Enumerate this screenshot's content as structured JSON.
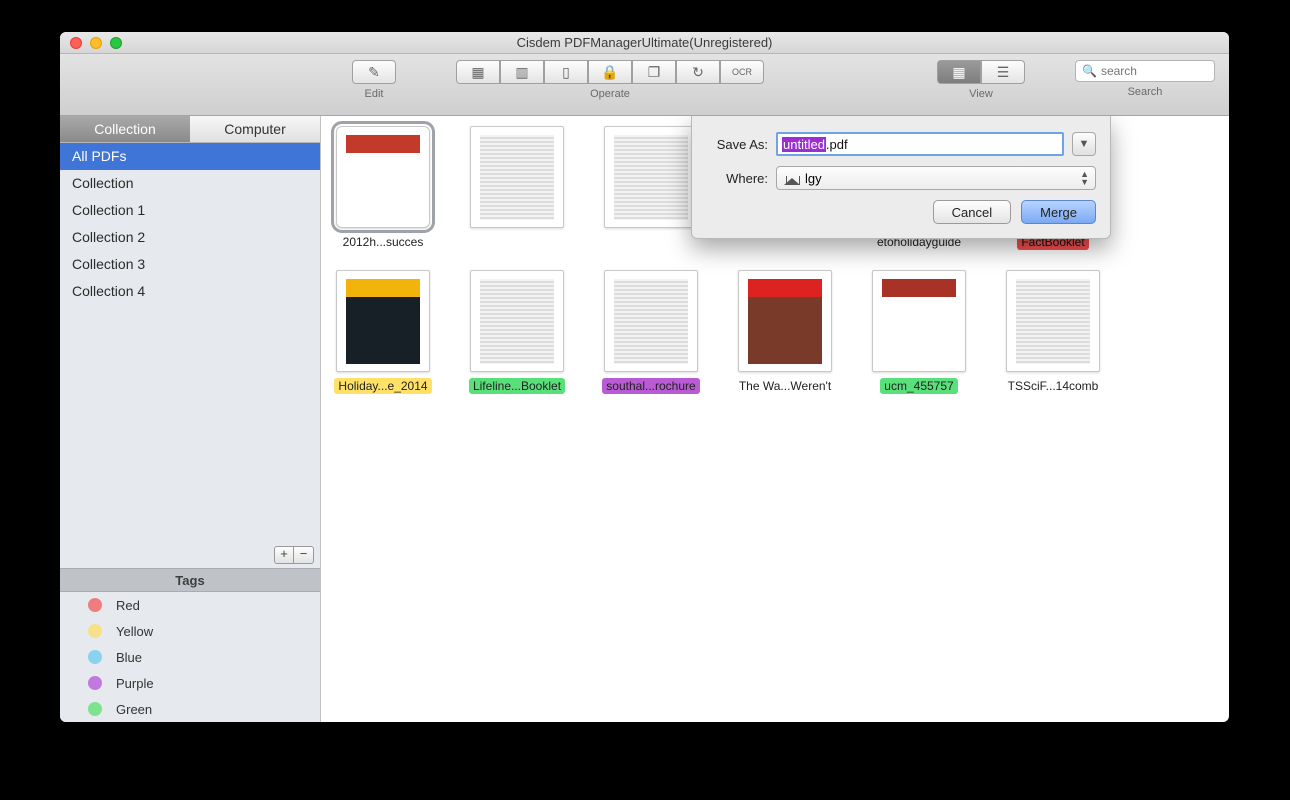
{
  "window": {
    "title": "Cisdem PDFManagerUltimate(Unregistered)"
  },
  "toolbar": {
    "edit_label": "Edit",
    "operate_label": "Operate",
    "view_label": "View",
    "search_label": "Search",
    "search_placeholder": "search"
  },
  "sidebar": {
    "tabs": {
      "collection": "Collection",
      "computer": "Computer"
    },
    "items": [
      {
        "label": "All PDFs",
        "selected": true
      },
      {
        "label": "Collection"
      },
      {
        "label": "Collection 1"
      },
      {
        "label": "Collection 2"
      },
      {
        "label": "Collection 3"
      },
      {
        "label": "Collection 4"
      }
    ],
    "tags_header": "Tags",
    "tags": [
      {
        "label": "Red",
        "color": "#f07d7d"
      },
      {
        "label": "Yellow",
        "color": "#f6e08a"
      },
      {
        "label": "Blue",
        "color": "#8ad3ef"
      },
      {
        "label": "Purple",
        "color": "#c07adf"
      },
      {
        "label": "Green",
        "color": "#7ee38f"
      }
    ]
  },
  "dialog": {
    "save_as_label": "Save As:",
    "where_label": "Where:",
    "filename_selected": "untitled",
    "filename_rest": ".pdf",
    "where_value": "lgy",
    "cancel": "Cancel",
    "merge": "Merge"
  },
  "files": [
    {
      "label": "2012h...succes",
      "tag": "none",
      "selected": true,
      "thumb_bg": "#fff",
      "thumb_accent": "#c43a2a"
    },
    {
      "label": "",
      "tag": "none",
      "thumb_bg": "#fff"
    },
    {
      "label": "",
      "tag": "none",
      "thumb_bg": "#fff"
    },
    {
      "label": "",
      "tag": "none",
      "thumb_bg": "#fff"
    },
    {
      "label": "etoholidayguide",
      "tag": "none",
      "thumb_bg": "#fff"
    },
    {
      "label": "FactBooklet",
      "tag": "red",
      "thumb_bg": "#0b1a23"
    },
    {
      "label": "Holiday...e_2014",
      "tag": "yellow",
      "thumb_bg": "#172027",
      "thumb_accent": "#f2b40a"
    },
    {
      "label": "Lifeline...Booklet",
      "tag": "green",
      "thumb_bg": "#0e0e0e"
    },
    {
      "label": "southal...rochure",
      "tag": "purple",
      "thumb_bg": "#b12e2a"
    },
    {
      "label": "The Wa...Weren't",
      "tag": "none",
      "thumb_bg": "#7a3a2a",
      "thumb_accent": "#d22"
    },
    {
      "label": "ucm_455757",
      "tag": "green",
      "thumb_bg": "#fff",
      "thumb_accent": "#a93226"
    },
    {
      "label": "TSSciF...14comb",
      "tag": "none",
      "thumb_bg": "#fff"
    }
  ]
}
